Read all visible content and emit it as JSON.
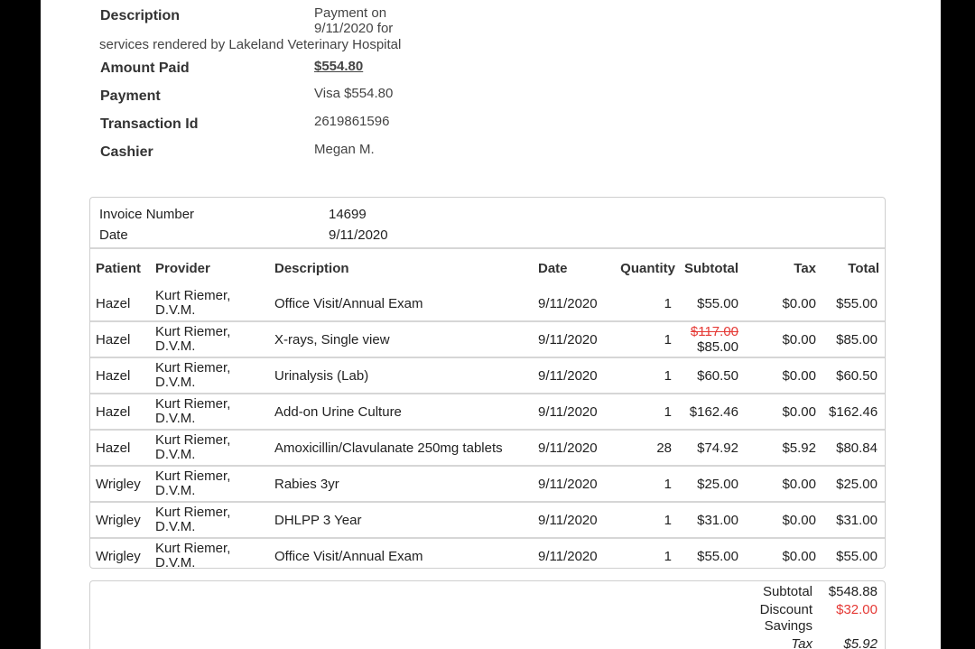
{
  "payment": {
    "description_label": "Description",
    "description_line1": "Payment on",
    "description_line2": "9/11/2020 for",
    "description_line3": "services rendered by Lakeland Veterinary Hospital",
    "amount_paid_label": "Amount Paid",
    "amount_paid_value": "$554.80",
    "payment_label": "Payment",
    "payment_value": "Visa $554.80",
    "transaction_label": "Transaction Id",
    "transaction_value": "2619861596",
    "cashier_label": "Cashier",
    "cashier_value": "Megan M."
  },
  "invoice": {
    "number_label": "Invoice Number",
    "number_value": "14699",
    "date_label": "Date",
    "date_value": "9/11/2020"
  },
  "table": {
    "headers": [
      "Patient",
      "Provider",
      "Description",
      "Date",
      "Quantity",
      "Subtotal",
      "Tax",
      "Total"
    ],
    "rows": [
      {
        "patient": "Hazel",
        "provider1": "Kurt Riemer,",
        "provider2": "D.V.M.",
        "description": "Office Visit/Annual Exam",
        "date": "9/11/2020",
        "quantity": "1",
        "subtotal": "$55.00",
        "tax": "$0.00",
        "total": "$55.00"
      },
      {
        "patient": "Hazel",
        "provider1": "Kurt Riemer,",
        "provider2": "D.V.M.",
        "description": "X-rays, Single view",
        "date": "9/11/2020",
        "quantity": "1",
        "subtotal_original": "$117.00",
        "subtotal": "$85.00",
        "tax": "$0.00",
        "total": "$85.00"
      },
      {
        "patient": "Hazel",
        "provider1": "Kurt Riemer,",
        "provider2": "D.V.M.",
        "description": "Urinalysis (Lab)",
        "date": "9/11/2020",
        "quantity": "1",
        "subtotal": "$60.50",
        "tax": "$0.00",
        "total": "$60.50"
      },
      {
        "patient": "Hazel",
        "provider1": "Kurt Riemer,",
        "provider2": "D.V.M.",
        "description": "Add-on Urine Culture",
        "date": "9/11/2020",
        "quantity": "1",
        "subtotal": "$162.46",
        "tax": "$0.00",
        "total": "$162.46"
      },
      {
        "patient": "Hazel",
        "provider1": "Kurt Riemer,",
        "provider2": "D.V.M.",
        "description": "Amoxicillin/Clavulanate 250mg tablets",
        "date": "9/11/2020",
        "quantity": "28",
        "subtotal": "$74.92",
        "tax": "$5.92",
        "total": "$80.84"
      },
      {
        "patient": "Wrigley",
        "provider1": "Kurt Riemer,",
        "provider2": "D.V.M.",
        "description": "Rabies 3yr",
        "date": "9/11/2020",
        "quantity": "1",
        "subtotal": "$25.00",
        "tax": "$0.00",
        "total": "$25.00"
      },
      {
        "patient": "Wrigley",
        "provider1": "Kurt Riemer,",
        "provider2": "D.V.M.",
        "description": "DHLPP 3 Year",
        "date": "9/11/2020",
        "quantity": "1",
        "subtotal": "$31.00",
        "tax": "$0.00",
        "total": "$31.00"
      },
      {
        "patient": "Wrigley",
        "provider1": "Kurt Riemer,",
        "provider2": "D.V.M.",
        "description": "Office Visit/Annual Exam",
        "date": "9/11/2020",
        "quantity": "1",
        "subtotal": "$55.00",
        "tax": "$0.00",
        "total": "$55.00"
      }
    ]
  },
  "totals": {
    "subtotal_label": "Subtotal",
    "subtotal_value": "$548.88",
    "discount_label": "Discount",
    "discount_value": "$32.00",
    "savings_label": "Savings",
    "tax_label": "Tax",
    "tax_value": "$5.92"
  },
  "colors": {
    "discount_red": "#e53935",
    "border": "#cfcfcf"
  }
}
